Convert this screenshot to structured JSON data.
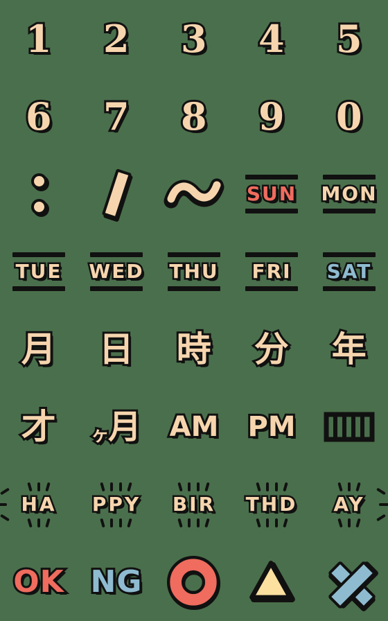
{
  "sheet": {
    "title": "Retro Date & Time Emoji Sticker Sheet",
    "background_color": "#4a6f4c",
    "columns": 5,
    "rows": 8,
    "palette": {
      "tan": "#f6d5ae",
      "red": "#ef6c5e",
      "blue": "#8fbbd0",
      "yellow": "#fbe0a0",
      "outline": "#111111"
    }
  },
  "stickers": [
    {
      "id": "digit-1",
      "label": "1",
      "kind": "digit",
      "color": "tan"
    },
    {
      "id": "digit-2",
      "label": "2",
      "kind": "digit",
      "color": "tan"
    },
    {
      "id": "digit-3",
      "label": "3",
      "kind": "digit",
      "color": "tan"
    },
    {
      "id": "digit-4",
      "label": "4",
      "kind": "digit",
      "color": "tan"
    },
    {
      "id": "digit-5",
      "label": "5",
      "kind": "digit",
      "color": "tan"
    },
    {
      "id": "digit-6",
      "label": "6",
      "kind": "digit",
      "color": "tan"
    },
    {
      "id": "digit-7",
      "label": "7",
      "kind": "digit",
      "color": "tan"
    },
    {
      "id": "digit-8",
      "label": "8",
      "kind": "digit",
      "color": "tan"
    },
    {
      "id": "digit-9",
      "label": "9",
      "kind": "digit",
      "color": "tan"
    },
    {
      "id": "digit-0",
      "label": "0",
      "kind": "digit",
      "color": "tan"
    },
    {
      "id": "colon",
      "label": ":",
      "kind": "shape-colon",
      "color": "tan"
    },
    {
      "id": "slash",
      "label": "/",
      "kind": "shape-slash",
      "color": "tan"
    },
    {
      "id": "tilde",
      "label": "~",
      "kind": "shape-tilde",
      "color": "tan"
    },
    {
      "id": "day-sun",
      "label": "SUN",
      "kind": "dayword",
      "color": "red"
    },
    {
      "id": "day-mon",
      "label": "MON",
      "kind": "dayword",
      "color": "tan"
    },
    {
      "id": "day-tue",
      "label": "TUE",
      "kind": "dayword",
      "color": "tan"
    },
    {
      "id": "day-wed",
      "label": "WED",
      "kind": "dayword",
      "color": "tan"
    },
    {
      "id": "day-thu",
      "label": "THU",
      "kind": "dayword",
      "color": "tan"
    },
    {
      "id": "day-fri",
      "label": "FRI",
      "kind": "dayword",
      "color": "tan"
    },
    {
      "id": "day-sat",
      "label": "SAT",
      "kind": "dayword",
      "color": "blue"
    },
    {
      "id": "kanji-month",
      "label": "月",
      "kind": "kanji",
      "color": "tan"
    },
    {
      "id": "kanji-day",
      "label": "日",
      "kind": "kanji",
      "color": "tan"
    },
    {
      "id": "kanji-hour",
      "label": "時",
      "kind": "kanji",
      "color": "tan"
    },
    {
      "id": "kanji-minute",
      "label": "分",
      "kind": "kanji",
      "color": "tan"
    },
    {
      "id": "kanji-year",
      "label": "年",
      "kind": "kanji",
      "color": "tan"
    },
    {
      "id": "kanji-age",
      "label": "才",
      "kind": "kanji",
      "color": "tan"
    },
    {
      "id": "kanji-kagetsu",
      "label": "ヶ月",
      "kind": "kanji-combo",
      "color": "tan",
      "pre": "ヶ",
      "main": "月"
    },
    {
      "id": "am",
      "label": "AM",
      "kind": "ampm",
      "color": "tan"
    },
    {
      "id": "pm",
      "label": "PM",
      "kind": "ampm",
      "color": "tan"
    },
    {
      "id": "tally",
      "label": "",
      "kind": "shape-tally",
      "color": "outline"
    },
    {
      "id": "hbd-ha",
      "label": "HA",
      "kind": "hbd",
      "color": "tan"
    },
    {
      "id": "hbd-ppy",
      "label": "PPY",
      "kind": "hbd",
      "color": "tan"
    },
    {
      "id": "hbd-bir",
      "label": "BIR",
      "kind": "hbd",
      "color": "tan"
    },
    {
      "id": "hbd-thd",
      "label": "THD",
      "kind": "hbd",
      "color": "tan"
    },
    {
      "id": "hbd-ay",
      "label": "AY",
      "kind": "hbd",
      "color": "tan"
    },
    {
      "id": "ok",
      "label": "OK",
      "kind": "okng",
      "color": "red"
    },
    {
      "id": "ng",
      "label": "NG",
      "kind": "okng",
      "color": "blue"
    },
    {
      "id": "circle-o",
      "label": "O",
      "kind": "shape-ring",
      "color": "red"
    },
    {
      "id": "triangle",
      "label": "△",
      "kind": "shape-triangle",
      "color": "yellow"
    },
    {
      "id": "cross-x",
      "label": "✕",
      "kind": "shape-cross",
      "color": "blue"
    }
  ]
}
